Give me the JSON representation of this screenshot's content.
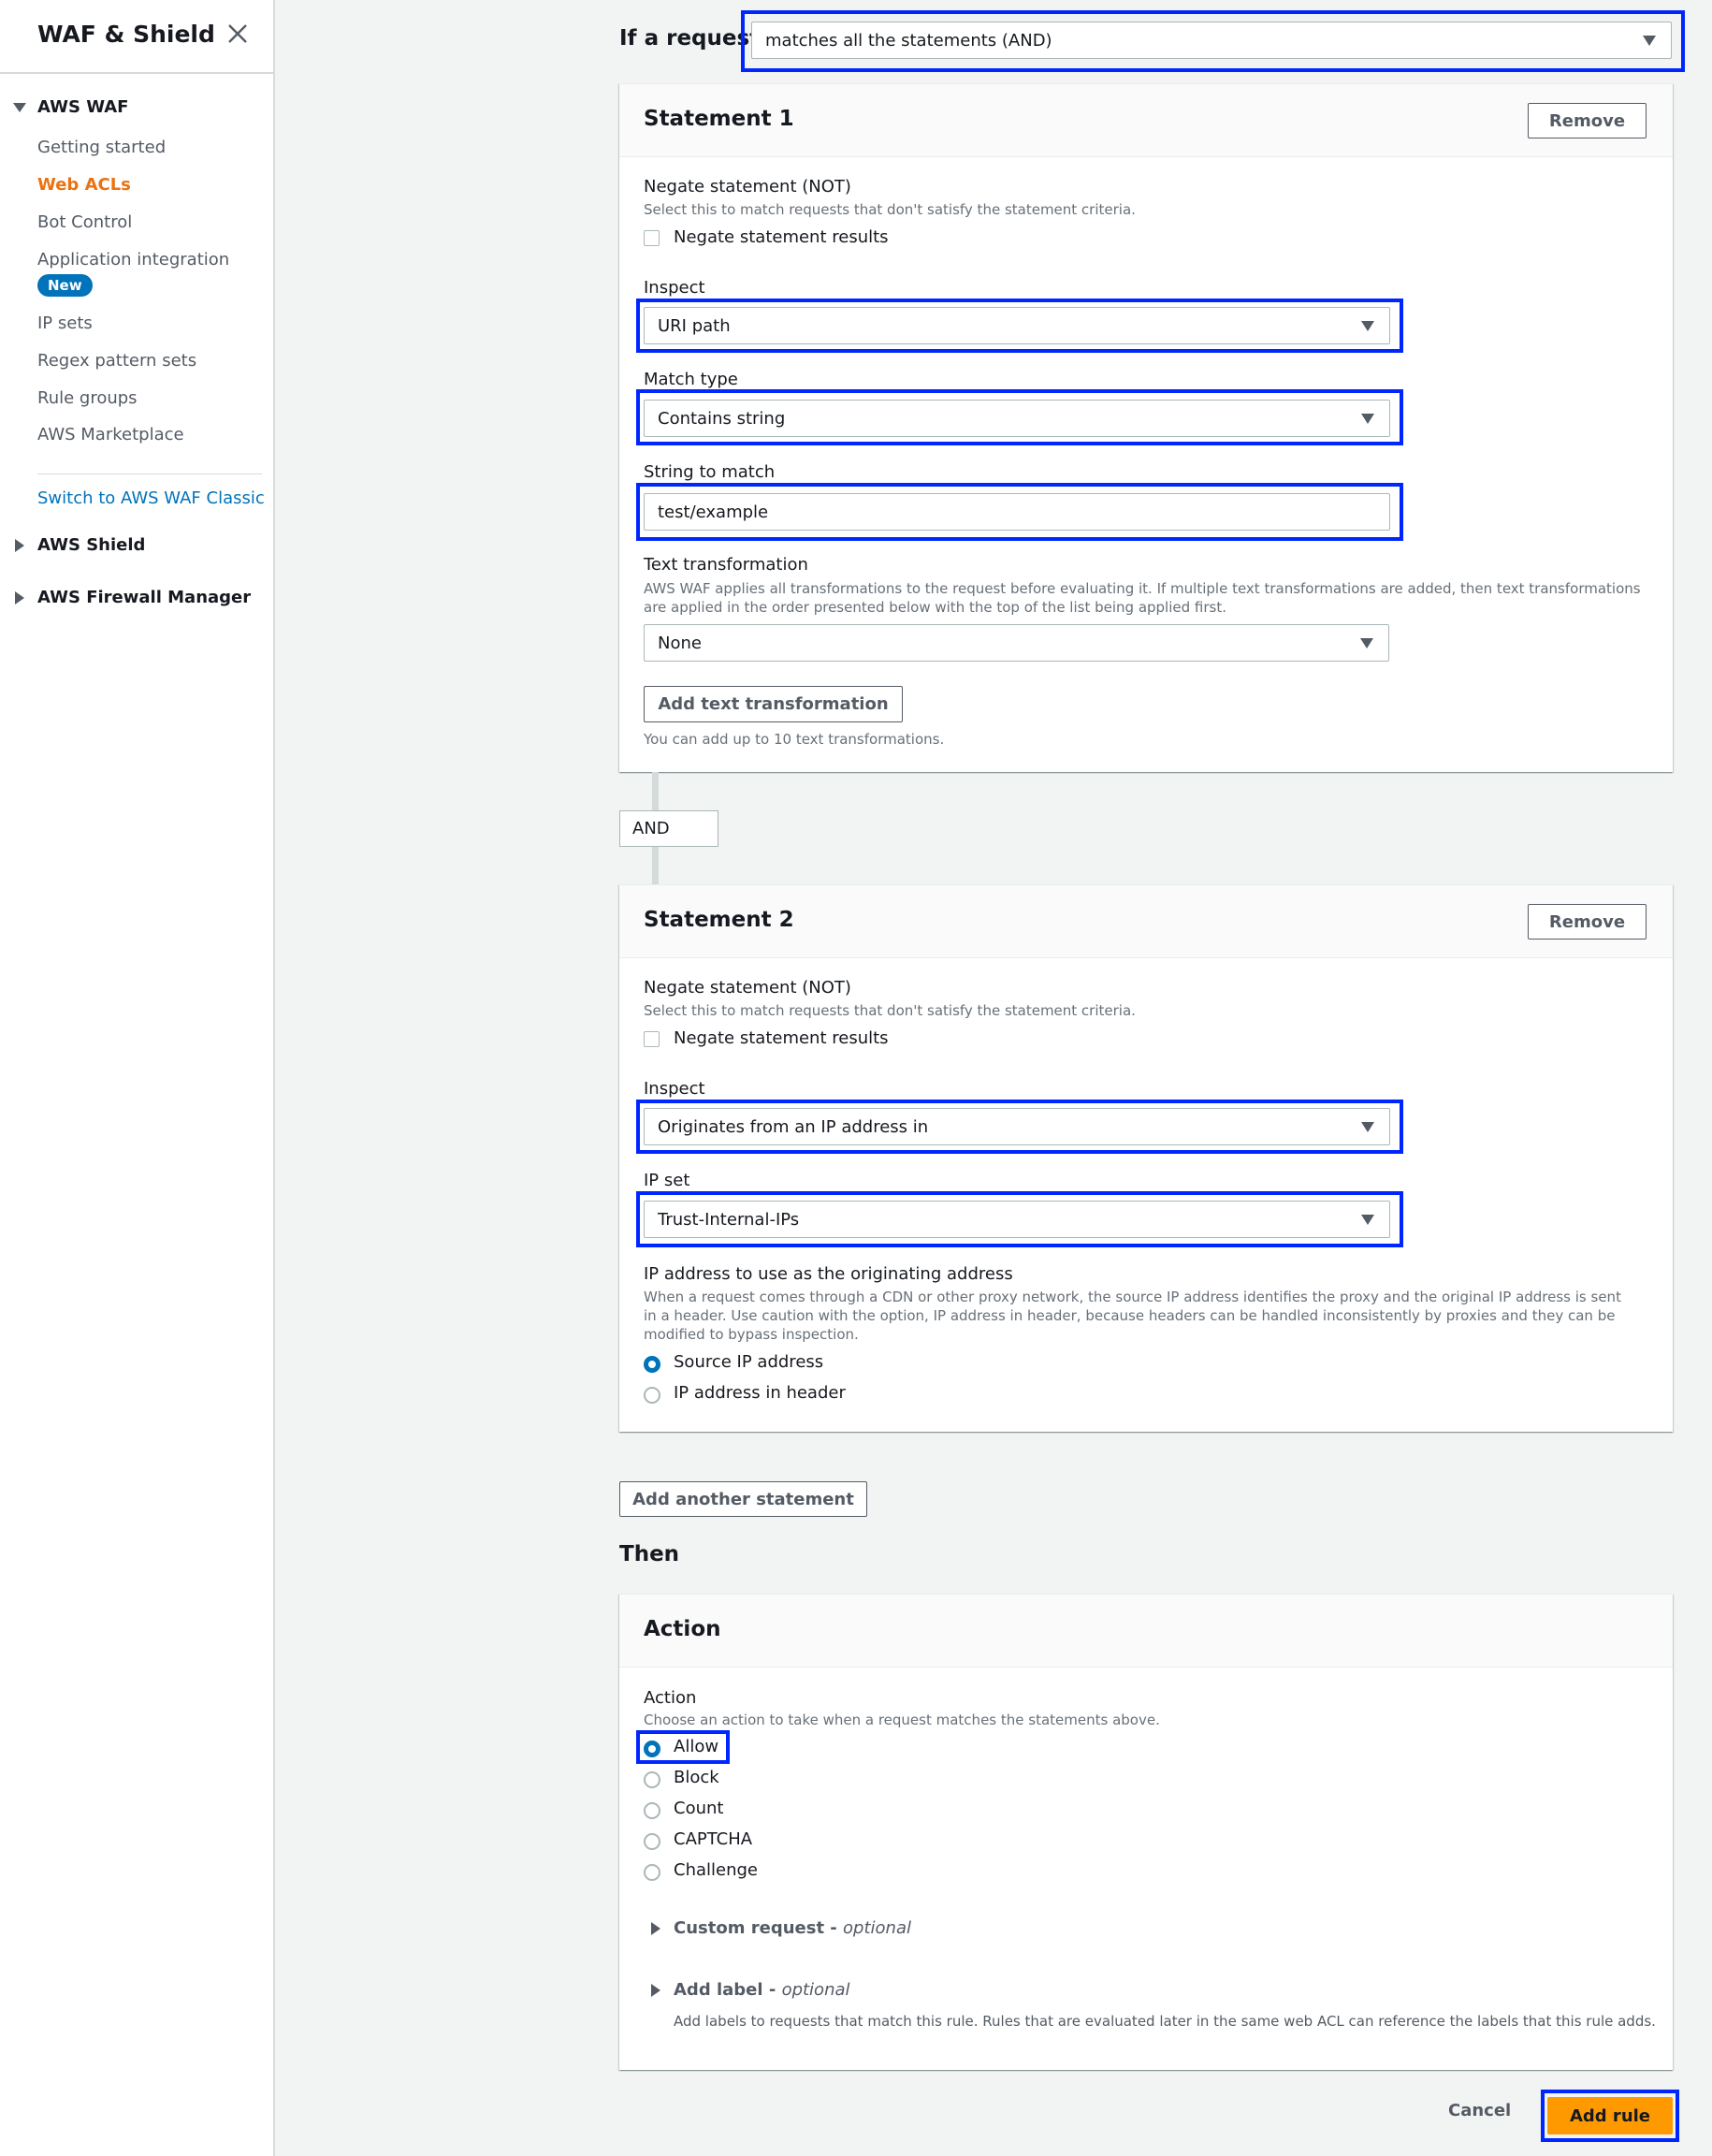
{
  "sidebar": {
    "title": "WAF & Shield",
    "close_icon": "close-icon",
    "sections": {
      "waf": {
        "label": "AWS WAF",
        "expanded": true
      },
      "shield": {
        "label": "AWS Shield",
        "expanded": false
      },
      "fm": {
        "label": "AWS Firewall Manager",
        "expanded": false
      }
    },
    "items": [
      {
        "label": "Getting started",
        "active": false
      },
      {
        "label": "Web ACLs",
        "active": true
      },
      {
        "label": "Bot Control",
        "active": false
      },
      {
        "label": "Application integration",
        "active": false,
        "badge": "New"
      },
      {
        "label": "IP sets",
        "active": false
      },
      {
        "label": "Regex pattern sets",
        "active": false
      },
      {
        "label": "Rule groups",
        "active": false
      },
      {
        "label": "AWS Marketplace",
        "active": false
      }
    ],
    "switch_link": "Switch to AWS WAF Classic"
  },
  "main": {
    "if_label": "If a request",
    "if_select": "matches all the statements (AND)",
    "and_label": "AND",
    "statements": [
      {
        "title": "Statement 1",
        "remove_label": "Remove",
        "negate_label": "Negate statement (NOT)",
        "negate_desc": "Select this to match requests that don't satisfy the statement criteria.",
        "negate_checkbox": "Negate statement results",
        "negate_checked": false,
        "inspect_label": "Inspect",
        "inspect_value": "URI path",
        "match_type_label": "Match type",
        "match_type_value": "Contains string",
        "string_label": "String to match",
        "string_value": "test/example",
        "text_transform_label": "Text transformation",
        "text_transform_desc": "AWS WAF applies all transformations to the request before evaluating it. If multiple text transformations are added, then text transformations are applied in the order presented below with the top of the list being applied first.",
        "text_transform_value": "None",
        "add_transform_button": "Add text transformation",
        "add_transform_hint": "You can add up to 10 text transformations."
      },
      {
        "title": "Statement 2",
        "remove_label": "Remove",
        "negate_label": "Negate statement (NOT)",
        "negate_desc": "Select this to match requests that don't satisfy the statement criteria.",
        "negate_checkbox": "Negate statement results",
        "negate_checked": false,
        "inspect_label": "Inspect",
        "inspect_value": "Originates from an IP address in",
        "ipset_label": "IP set",
        "ipset_value": "Trust-Internal-IPs",
        "origin_label": "IP address to use as the originating address",
        "origin_desc": "When a request comes through a CDN or other proxy network, the source IP address identifies the proxy and the original IP address is sent in a header. Use caution with the option, IP address in header, because headers can be handled inconsistently by proxies and they can be modified to bypass inspection.",
        "origin_options": [
          {
            "label": "Source IP address",
            "selected": true
          },
          {
            "label": "IP address in header",
            "selected": false
          }
        ]
      }
    ],
    "add_statement_button": "Add another statement",
    "then_label": "Then",
    "action_card": {
      "title": "Action",
      "action_label": "Action",
      "action_desc": "Choose an action to take when a request matches the statements above.",
      "options": [
        {
          "label": "Allow",
          "selected": true
        },
        {
          "label": "Block",
          "selected": false
        },
        {
          "label": "Count",
          "selected": false
        },
        {
          "label": "CAPTCHA",
          "selected": false
        },
        {
          "label": "Challenge",
          "selected": false
        }
      ],
      "custom_request": {
        "label": "Custom request - ",
        "optional": "optional"
      },
      "add_label": {
        "label": "Add label - ",
        "optional": "optional",
        "desc": "Add labels to requests that match this rule. Rules that are evaluated later in the same web ACL can reference the labels that this rule adds."
      }
    },
    "footer": {
      "cancel_label": "Cancel",
      "submit_label": "Add rule"
    }
  },
  "colors": {
    "highlight": "#0026ff",
    "primary_button": "#ff9900",
    "active_nav": "#ec7211",
    "link": "#0073bb"
  }
}
